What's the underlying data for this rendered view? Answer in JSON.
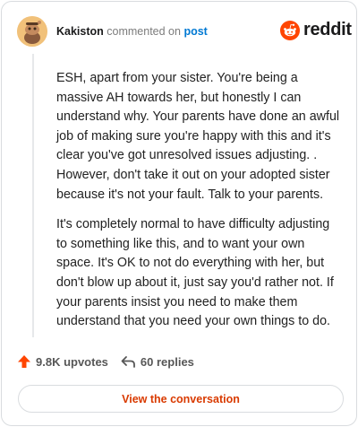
{
  "header": {
    "username": "Kakiston",
    "action_text": "commented on",
    "post_link": "post"
  },
  "brand": {
    "logo_text": "reddit",
    "color": "#ff4500"
  },
  "comment": {
    "paragraphs": [
      "ESH, apart from your sister. You're being a massive AH towards her, but honestly I can understand why. Your parents have done an awful job of making sure you're happy with this and it's clear you've got unresolved issues adjusting. . However, don't take it out on your adopted sister because it's not your fault. Talk to your parents.",
      "It's completely normal to have difficulty adjusting to something like this, and to want your own space. It's OK to not do everything with her, but don't blow up about it, just say you'd rather not. If your parents insist you need to make them understand that you need your own things to do."
    ]
  },
  "stats": {
    "upvotes": "9.8K upvotes",
    "replies": "60 replies",
    "upvote_color": "#ff4500"
  },
  "cta": {
    "label": "View the conversation",
    "color": "#d93a00"
  },
  "icons": {
    "avatar": "snoo-avatar-icon",
    "logo": "reddit-snoo-icon",
    "upvote": "upvote-arrow-icon",
    "reply": "reply-arrow-icon"
  }
}
